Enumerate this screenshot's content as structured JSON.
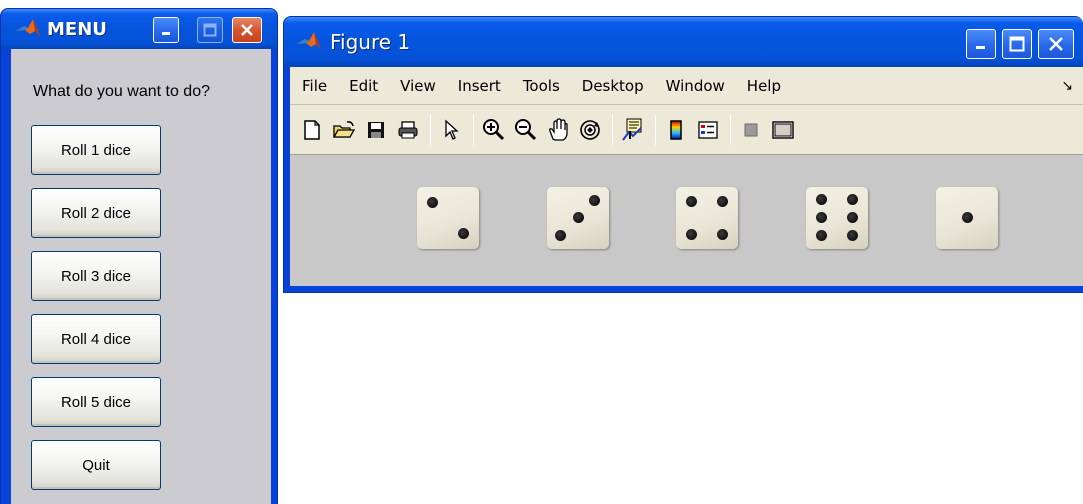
{
  "menu_window": {
    "title": "MENU",
    "prompt": "What do you want to do?",
    "buttons": [
      "Roll 1 dice",
      "Roll 2 dice",
      "Roll 3 dice",
      "Roll 4 dice",
      "Roll 5 dice",
      "Quit"
    ]
  },
  "figure_window": {
    "title": "Figure 1",
    "menu": [
      "File",
      "Edit",
      "View",
      "Insert",
      "Tools",
      "Desktop",
      "Window",
      "Help"
    ],
    "toolbar_icons": [
      "new-figure-icon",
      "open-file-icon",
      "save-icon",
      "print-icon",
      "edit-plot-arrow-icon",
      "zoom-in-icon",
      "zoom-out-icon",
      "pan-hand-icon",
      "rotate-3d-icon",
      "data-cursor-icon",
      "colorbar-icon",
      "legend-icon",
      "hide-plot-tools-icon",
      "show-plot-tools-icon"
    ],
    "dice_values": [
      2,
      3,
      4,
      6,
      1
    ]
  },
  "colors": {
    "title_blue": "#0654dc",
    "close_red": "#d9542c",
    "menu_bg": "#ccccd0",
    "figure_bg": "#c8c8c8",
    "toolbar_bg": "#ece9d8"
  }
}
